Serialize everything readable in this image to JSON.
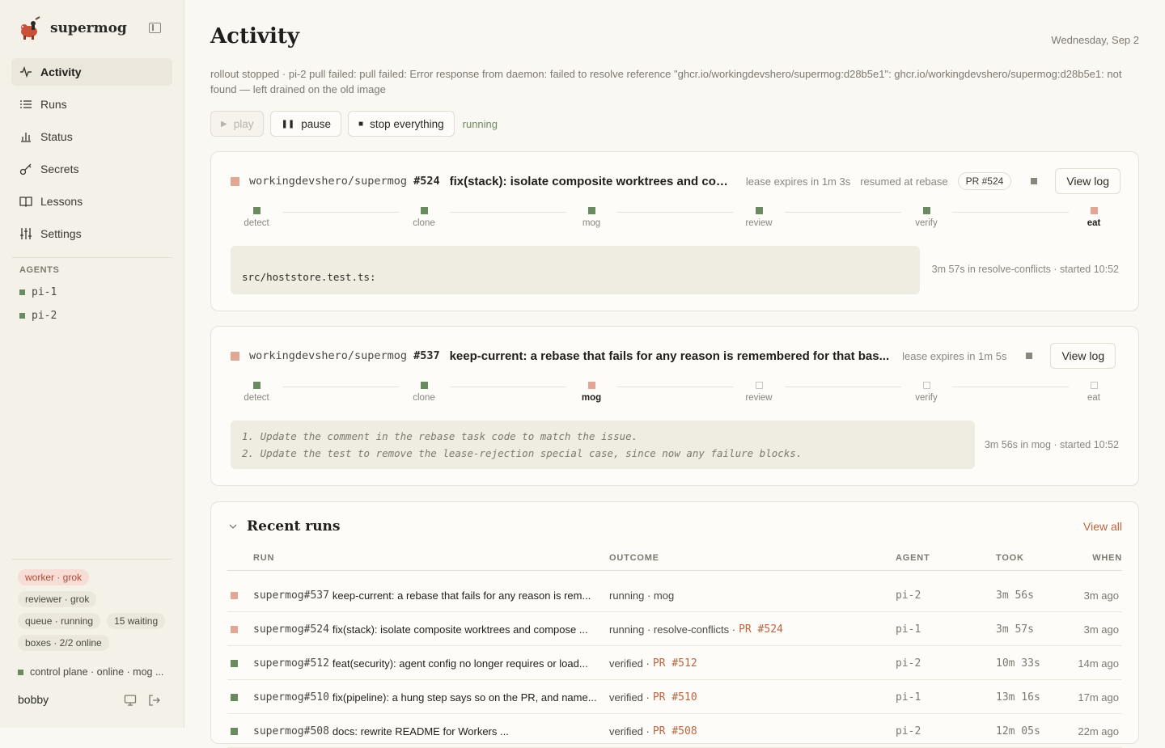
{
  "app": {
    "name": "supermog"
  },
  "nav": [
    {
      "label": "Activity",
      "icon": "activity-icon",
      "active": true
    },
    {
      "label": "Runs",
      "icon": "list-icon",
      "active": false
    },
    {
      "label": "Status",
      "icon": "bar-chart-icon",
      "active": false
    },
    {
      "label": "Secrets",
      "icon": "key-icon",
      "active": false
    },
    {
      "label": "Lessons",
      "icon": "book-icon",
      "active": false
    },
    {
      "label": "Settings",
      "icon": "sliders-icon",
      "active": false
    }
  ],
  "agents": {
    "title": "AGENTS",
    "items": [
      "pi-1",
      "pi-2"
    ]
  },
  "chips": {
    "worker": "worker · grok",
    "reviewer": "reviewer · grok",
    "queue": "queue · running",
    "waiting": "15 waiting",
    "boxes": "boxes · 2/2 online"
  },
  "control_plane": "control plane · online · mog ...",
  "user": "bobby",
  "page": {
    "title": "Activity",
    "date": "Wednesday, Sep 2",
    "alert": "rollout stopped · pi-2 pull failed: pull failed: Error response from daemon: failed to resolve reference \"ghcr.io/workingdevshero/supermog:d28b5e1\": ghcr.io/workingdevshero/supermog:d28b5e1: not found — left drained on the old image"
  },
  "controls": {
    "play": "play",
    "pause": "pause",
    "stop": "stop everything",
    "state": "running"
  },
  "tasks": [
    {
      "repo": "workingdevshero/supermog",
      "num": "#524",
      "title": "fix(stack): isolate composite worktrees and com...",
      "lease": "lease expires in 1m 3s",
      "resumed": "resumed at rebase",
      "pr": "PR #524",
      "view_log": "View log",
      "stages": [
        "detect",
        "clone",
        "mog",
        "review",
        "verify",
        "eat"
      ],
      "log": "src/hoststore.test.ts:",
      "elapsed": "3m 57s in resolve-conflicts · started 10:52"
    },
    {
      "repo": "workingdevshero/supermog",
      "num": "#537",
      "title": "keep-current: a rebase that fails for any reason is remembered for that bas...",
      "lease": "lease expires in 1m 5s",
      "view_log": "View log",
      "stages": [
        "detect",
        "clone",
        "mog",
        "review",
        "verify",
        "eat"
      ],
      "log_lines": [
        "1. Update the comment in the rebase task code to match the issue.",
        "2. Update the test to remove the lease-rejection special case, since now any failure blocks."
      ],
      "elapsed": "3m 56s in mog · started 10:52"
    }
  ],
  "recent": {
    "title": "Recent runs",
    "view_all": "View all",
    "columns": {
      "run": "RUN",
      "outcome": "OUTCOME",
      "agent": "AGENT",
      "took": "TOOK",
      "when": "WHEN"
    },
    "rows": [
      {
        "id": "supermog#537",
        "title": "keep-current: a rebase that fails for any reason is rem...",
        "outcome": "running · mog",
        "pr": "",
        "agent": "pi-2",
        "took": "3m 56s",
        "when": "3m ago",
        "state": "running"
      },
      {
        "id": "supermog#524",
        "title": "fix(stack): isolate composite worktrees and compose ...",
        "outcome": "running · resolve-conflicts ·",
        "pr": "PR #524",
        "agent": "pi-1",
        "took": "3m 57s",
        "when": "3m ago",
        "state": "running"
      },
      {
        "id": "supermog#512",
        "title": "feat(security): agent config no longer requires or load...",
        "outcome": "verified ·",
        "pr": "PR #512",
        "agent": "pi-2",
        "took": "10m 33s",
        "when": "14m ago",
        "state": "verified"
      },
      {
        "id": "supermog#510",
        "title": "fix(pipeline): a hung step says so on the PR, and name...",
        "outcome": "verified ·",
        "pr": "PR #510",
        "agent": "pi-1",
        "took": "13m 16s",
        "when": "17m ago",
        "state": "verified"
      },
      {
        "id": "supermog#508",
        "title": "docs: rewrite README for Workers ...",
        "outcome": "verified ·",
        "pr": "PR #508",
        "agent": "pi-2",
        "took": "12m 05s",
        "when": "22m ago",
        "state": "verified"
      }
    ]
  },
  "colors": {
    "accent": "#c0643f",
    "ok": "#6b8a62",
    "running": "#e2a694"
  }
}
